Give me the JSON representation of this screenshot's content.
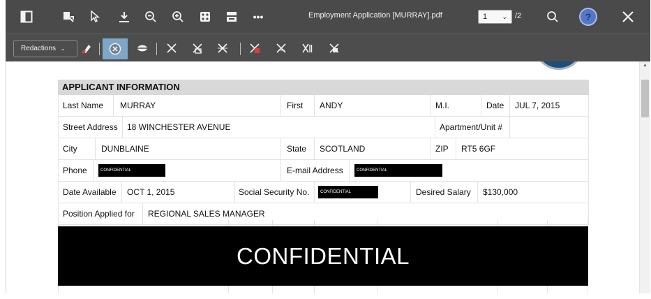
{
  "toolbar": {
    "icons": [
      "sidebar-toggle-icon",
      "select-text-icon",
      "pointer-icon",
      "download-icon",
      "zoom-out-icon",
      "zoom-in-icon",
      "dice-icon",
      "print-icon",
      "more-options-icon",
      "search-icon",
      "help-icon",
      "close-icon"
    ],
    "more_label": "•••",
    "file_title": "Employment Application [MURRAY].pdf",
    "page_current": "1",
    "page_total": "/2",
    "help_label": "?"
  },
  "redact_toolbar": {
    "redactions_label": "Redactions",
    "dropdown_chevron": "⌄",
    "tools": [
      "mark-redaction-icon",
      "apply-redaction-icon",
      "eye-icon",
      "clear-redaction-icon",
      "redact-page-icon",
      "redact-area-icon",
      "redact-marked-icon",
      "redact-text-icon",
      "redact-all-icon",
      "redact-search-icon"
    ]
  },
  "form": {
    "section_title": "APPLICANT INFORMATION",
    "row1": {
      "last_name_label": "Last Name",
      "last_name": "MURRAY",
      "first_label": "First",
      "first": "ANDY",
      "mi_label": "M.I.",
      "date_label": "Date",
      "date": "JUL 7, 2015"
    },
    "row2": {
      "street_label": "Street Address",
      "street": "18 WINCHESTER AVENUE",
      "apt_label": "Apartment/Unit #"
    },
    "row3": {
      "city_label": "City",
      "city": "DUNBLAINE",
      "state_label": "State",
      "state": "SCOTLAND",
      "zip_label": "ZIP",
      "zip": "RT5 6GF"
    },
    "row4": {
      "phone_label": "Phone",
      "phone_redaction": "CONFIDENTIAL",
      "email_label": "E-mail Address",
      "email_redaction": "CONFIDENTIAL"
    },
    "row5": {
      "date_available_label": "Date Available",
      "date_available": "OCT 1, 2015",
      "ssn_label": "Social Security No.",
      "ssn_redaction": "CONFIDENTIAL",
      "salary_label": "Desired Salary",
      "salary": "$130,000"
    },
    "row6": {
      "position_label": "Position Applied for",
      "position": "REGIONAL SALES MANAGER"
    },
    "block_redaction": "CONFIDENTIAL"
  },
  "colors": {
    "toolbar_bg": "#4a4a4a",
    "redaction_bg": "#000000",
    "active_tool_bg": "#7ea6c7",
    "section_header_bg": "#d9d9d9",
    "help_button": "#5577c8"
  }
}
